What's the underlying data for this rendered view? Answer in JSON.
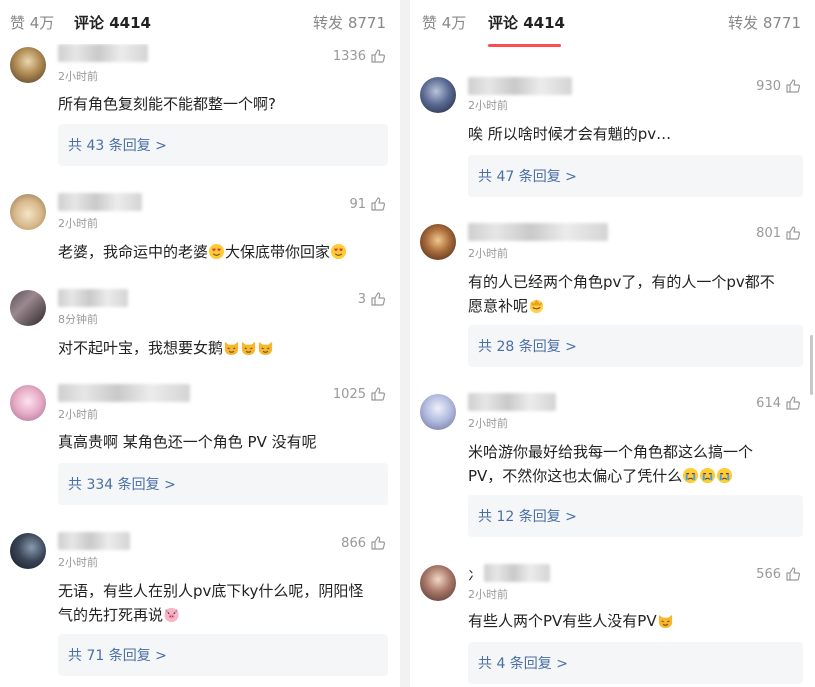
{
  "left": {
    "tabs": {
      "like": "赞 4万",
      "comment": "评论 4414",
      "repost": "转发 8771"
    },
    "comments": [
      {
        "time": "2小时前",
        "likes": "1336",
        "text": "所有角色复刻能不能都整一个啊?",
        "replies": "共 43 条回复 >"
      },
      {
        "time": "2小时前",
        "likes": "91",
        "text_a": "老婆，我命运中的老婆",
        "text_b": "大保底带你回家",
        "replies": ""
      },
      {
        "time": "8分钟前",
        "likes": "3",
        "text": "对不起叶宝，我想要女鹅",
        "replies": ""
      },
      {
        "time": "2小时前",
        "likes": "1025",
        "text": "真高贵啊 某角色还一个角色 PV 没有呢",
        "replies": "共 334 条回复 >"
      },
      {
        "time": "2小时前",
        "likes": "866",
        "line1": "无语，有些人在别人pv底下ky什么呢，阴阳怪",
        "line2": "气的先打死再说",
        "replies": "共 71 条回复 >"
      }
    ]
  },
  "right": {
    "tabs": {
      "like": "赞 4万",
      "comment": "评论 4414",
      "repost": "转发 8771"
    },
    "comments": [
      {
        "time": "2小时前",
        "likes": "930",
        "text": "唉 所以啥时候才会有魈的pv…",
        "replies": "共 47 条回复 >"
      },
      {
        "time": "2小时前",
        "likes": "801",
        "line1": "有的人已经两个角色pv了，有的人一个pv都不",
        "line2": "愿意补呢",
        "replies": "共 28 条回复 >"
      },
      {
        "time": "2小时前",
        "likes": "614",
        "line1": "米哈游你最好给我每一个角色都这么搞一个",
        "line2": "PV，不然你这也太偏心了凭什么",
        "replies": "共 12 条回复 >"
      },
      {
        "time": "2小时前",
        "likes": "566",
        "prefix": "冫",
        "text": "有些人两个PV有些人没有PV",
        "replies": "共 4 条回复 >"
      }
    ]
  },
  "colors": {
    "accent": "#ff4d4f",
    "link": "#4a6fa5",
    "reply_bg": "#f5f6f8",
    "muted": "#999999"
  },
  "icons": [
    "thumb-up-icon",
    "emoji-heart-eyes",
    "emoji-cat",
    "emoji-crying",
    "emoji-pig"
  ]
}
